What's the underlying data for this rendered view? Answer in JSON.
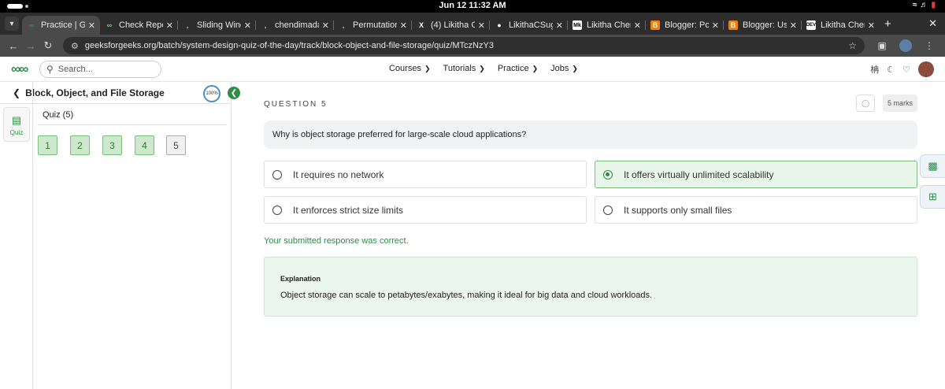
{
  "os": {
    "clock": "Jun 12  11:32 AM"
  },
  "browser": {
    "tabs": [
      {
        "title": "Practice | Ge",
        "favicon": "gfg-icon",
        "active": true
      },
      {
        "title": "Check Repe",
        "favicon": "gfg-icon",
        "active": false
      },
      {
        "title": "Sliding Wind",
        "favicon": "hook-icon",
        "active": false
      },
      {
        "title": "chendimada",
        "favicon": "hook-icon",
        "active": false
      },
      {
        "title": "Permutation",
        "favicon": "hook-icon",
        "active": false
      },
      {
        "title": "(4) Likitha C",
        "favicon": "x-icon",
        "active": false
      },
      {
        "title": "LikithaCSug",
        "favicon": "github-icon",
        "active": false
      },
      {
        "title": "Likitha Chen",
        "favicon": "medium-icon",
        "active": false
      },
      {
        "title": "Blogger: Pos",
        "favicon": "blogger-icon",
        "active": false
      },
      {
        "title": "Blogger: Use",
        "favicon": "blogger-icon",
        "active": false
      },
      {
        "title": "Likitha Chen",
        "favicon": "dev-icon",
        "active": false
      }
    ],
    "url": "geeksforgeeks.org/batch/system-design-quiz-of-the-day/track/block-object-and-file-storage/quiz/MTczNzY3"
  },
  "header": {
    "search_placeholder": "Search...",
    "menu": [
      {
        "label": "Courses"
      },
      {
        "label": "Tutorials"
      },
      {
        "label": "Practice"
      },
      {
        "label": "Jobs"
      }
    ]
  },
  "sidebar": {
    "title": "Block, Object, and File Storage",
    "progress": "100%",
    "rail_label": "Quiz",
    "quiz_title": "Quiz (5)",
    "questions": [
      "1",
      "2",
      "3",
      "4",
      "5"
    ],
    "current_question": 5
  },
  "main": {
    "question_label": "QUESTION 5",
    "marks": "5 marks",
    "question_text": "Why is object storage preferred for large-scale cloud applications?",
    "options": [
      {
        "text": "It requires no network",
        "selected": false
      },
      {
        "text": "It offers virtually unlimited scalability",
        "selected": true
      },
      {
        "text": "It enforces strict size limits",
        "selected": false
      },
      {
        "text": "It supports only small files",
        "selected": false
      }
    ],
    "feedback": "Your submitted response was correct.",
    "explanation_heading": "Explanation",
    "explanation_text": "Object storage can scale to petabytes/exabytes, making it ideal for big data and cloud workloads."
  },
  "colors": {
    "brand_green": "#2f8d46",
    "selected_bg": "#e8f5e9",
    "explanation_bg": "#ebf6ee"
  }
}
